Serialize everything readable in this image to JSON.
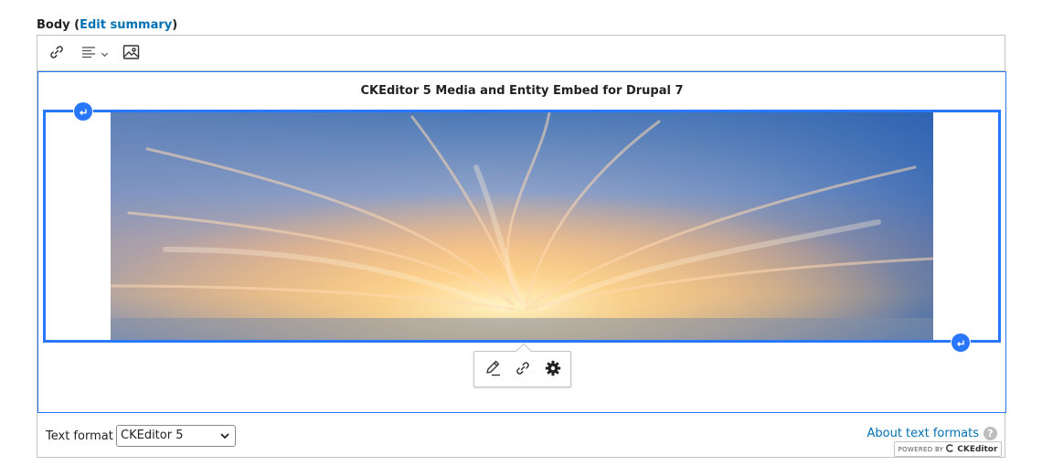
{
  "field": {
    "label": "Body",
    "open_paren": "(",
    "edit_summary_link": "Edit summary",
    "close_paren": ")"
  },
  "toolbar": {
    "items": [
      {
        "name": "link-icon"
      },
      {
        "name": "align-left-icon"
      },
      {
        "name": "image-icon"
      }
    ]
  },
  "content": {
    "title": "CKEditor 5 Media and Entity Embed for Drupal 7"
  },
  "balloon": {
    "items": [
      {
        "name": "edit-pencil-icon"
      },
      {
        "name": "link-icon"
      },
      {
        "name": "gear-icon"
      }
    ]
  },
  "powered_by": {
    "prefix": "POWERED BY",
    "brand": "CKEditor"
  },
  "footer": {
    "text_format_label": "Text format",
    "text_format_value": "CKEditor 5",
    "about_link": "About text formats",
    "help_icon_glyph": "?"
  },
  "colors": {
    "accent": "#2977ff",
    "link": "#0071b3",
    "border": "#c4c4c4"
  }
}
